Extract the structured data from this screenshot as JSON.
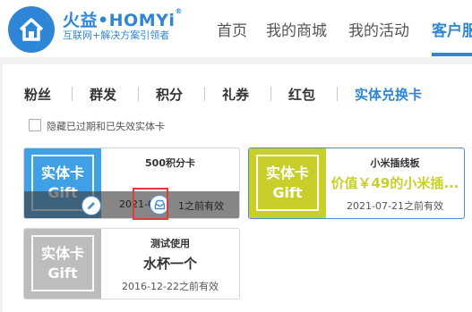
{
  "header": {
    "brand": "火益•HOMYi",
    "brand_mark": "®",
    "tagline": "互联网+解决方案引领者",
    "nav": [
      {
        "label": "首页"
      },
      {
        "label": "我的商城"
      },
      {
        "label": "我的活动"
      },
      {
        "label": "客户服"
      }
    ]
  },
  "tabs": [
    {
      "label": "粉丝"
    },
    {
      "label": "群发"
    },
    {
      "label": "积分"
    },
    {
      "label": "礼券"
    },
    {
      "label": "红包"
    },
    {
      "label": "实体兑换卡"
    }
  ],
  "filter": {
    "hide_expired_label": "隐藏已过期和已失效实体卡"
  },
  "cards": [
    {
      "line1": "实体卡",
      "line2": "Gift",
      "title": "500积分卡",
      "value": "",
      "date": "2021-0?-?1之前有效",
      "date_visible_left": "2021-0",
      "date_visible_right": "1之前有效"
    },
    {
      "line1": "实体卡",
      "line2": "Gift",
      "title": "小米插线板",
      "value": "价值￥49的小米插...",
      "date": "2021-07-21之前有效"
    },
    {
      "line1": "实体卡",
      "line2": "Gift",
      "title": "测试使用",
      "value": "水杯一个",
      "date": "2016-12-22之前有效"
    }
  ],
  "colors": {
    "accent": "#2f86d6",
    "card1_bg": "#3fa0e6",
    "card2_bg": "#c8cf2a",
    "card3_bg": "#bdbdbd",
    "card2_value": "#c8cf2a",
    "highlight": "#e53935"
  },
  "icons": {
    "logo": "house-logo-icon",
    "edit": "pencil-icon",
    "archive": "inbox-icon"
  }
}
